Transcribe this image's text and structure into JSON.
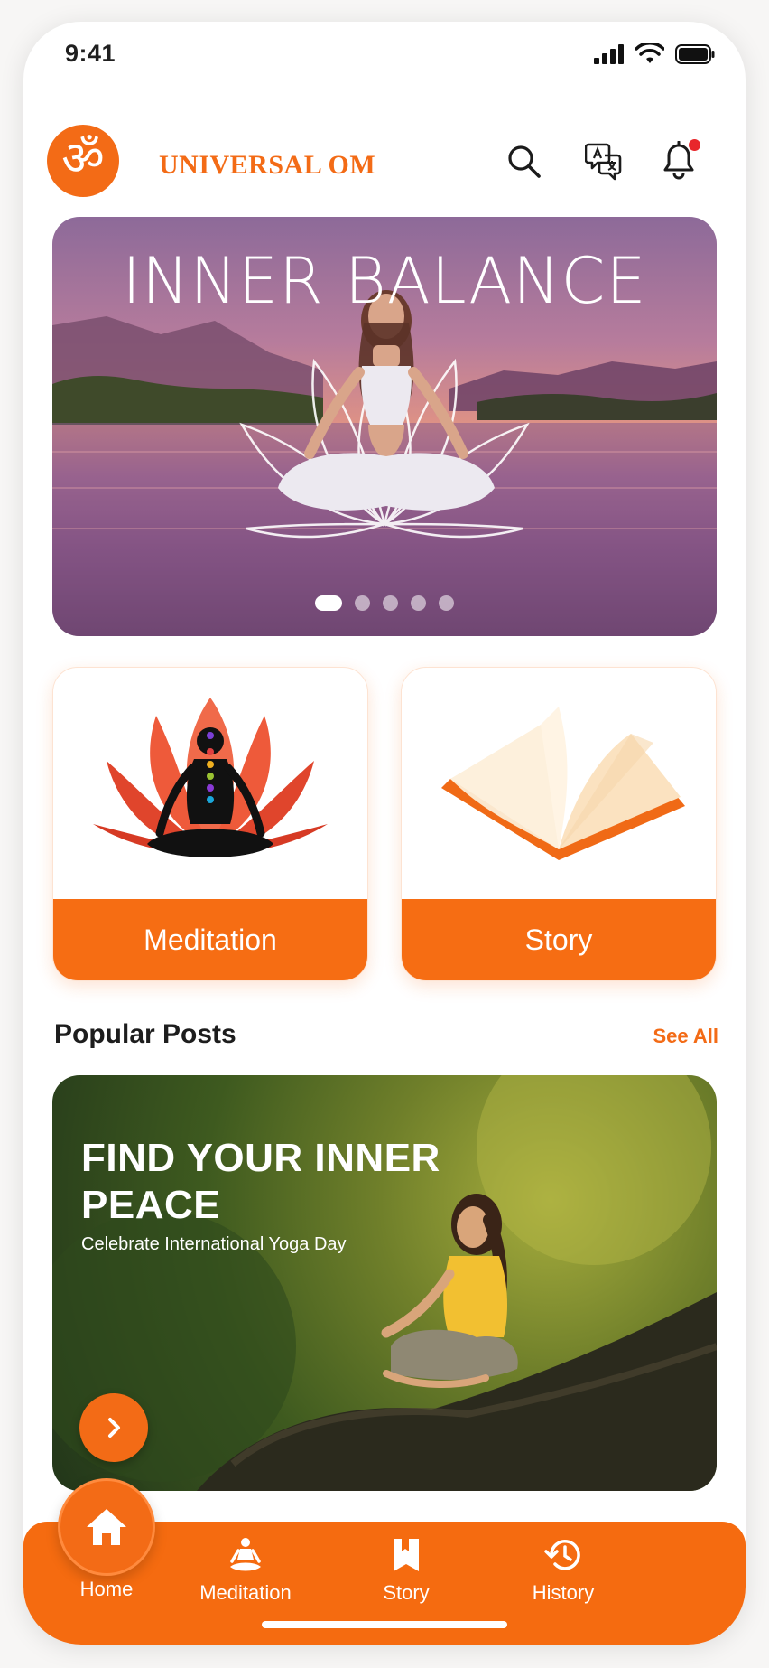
{
  "status_bar": {
    "time": "9:41"
  },
  "header": {
    "logo_glyph": "ॐ",
    "brand": "UNIVERSAL OM",
    "icons": [
      "search-icon",
      "translate-icon",
      "bell-icon"
    ]
  },
  "hero": {
    "title": "INNER BALANCE",
    "slide_count": 5,
    "active_slide": 1
  },
  "categories": [
    {
      "label": "Meditation",
      "icon": "lotus-meditation-icon"
    },
    {
      "label": "Story",
      "icon": "open-book-icon"
    }
  ],
  "popular": {
    "section_title": "Popular Posts",
    "see_all": "See All",
    "post": {
      "title": "FIND YOUR INNER PEACE",
      "subtitle": "Celebrate International Yoga Day"
    }
  },
  "nav": {
    "items": [
      {
        "label": "Home",
        "icon": "home-icon",
        "active": true
      },
      {
        "label": "Meditation",
        "icon": "meditation-icon"
      },
      {
        "label": "Story",
        "icon": "bookmark-book-icon"
      },
      {
        "label": "History",
        "icon": "history-icon"
      }
    ]
  },
  "colors": {
    "accent": "#f36b16",
    "notification": "#e8262b"
  }
}
